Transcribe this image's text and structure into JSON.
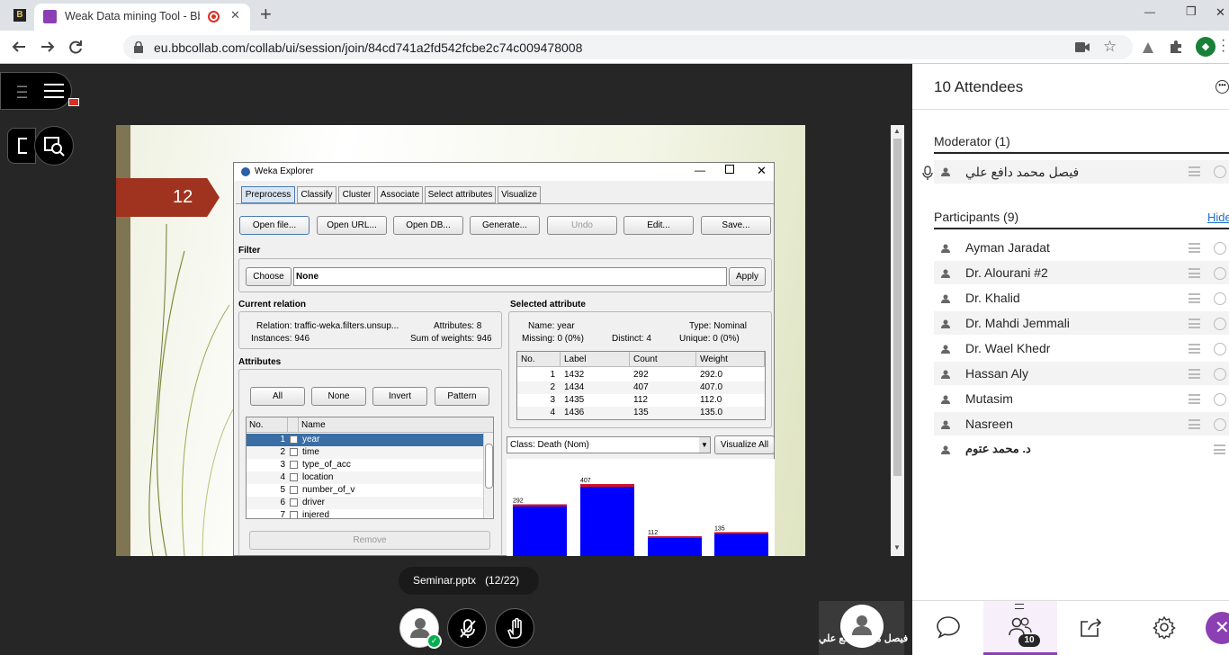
{
  "browser": {
    "tab_title": "Weak Data mining Tool - Bb",
    "url": "eu.bbcollab.com/collab/ui/session/join/84cd741a2fd542fcbe2c74c009478008",
    "pinned_tab_letter": "B",
    "profile_letter": "◆",
    "new_tab": "+",
    "window": {
      "minimize": "—",
      "restore": "❐",
      "close": "✕"
    }
  },
  "slide": {
    "number": "12",
    "file_label": "Seminar.pptx",
    "page_label": "(12/22)"
  },
  "weka": {
    "title": "Weka Explorer",
    "tabs": [
      "Preprocess",
      "Classify",
      "Cluster",
      "Associate",
      "Select attributes",
      "Visualize"
    ],
    "buttons": {
      "open_file": "Open file...",
      "open_url": "Open URL...",
      "open_db": "Open DB...",
      "generate": "Generate...",
      "undo": "Undo",
      "edit": "Edit...",
      "save": "Save..."
    },
    "filter": {
      "label": "Filter",
      "choose": "Choose",
      "value": "None",
      "apply": "Apply"
    },
    "relation": {
      "header": "Current relation",
      "relation": "Relation: traffic-weka.filters.unsup...",
      "instances": "Instances: 946",
      "attributes": "Attributes: 8",
      "weights": "Sum of weights: 946"
    },
    "attributes": {
      "header": "Attributes",
      "all": "All",
      "none": "None",
      "invert": "Invert",
      "pattern": "Pattern",
      "col_no": "No.",
      "col_name": "Name",
      "remove": "Remove",
      "rows": [
        {
          "no": "1",
          "name": "year"
        },
        {
          "no": "2",
          "name": "time"
        },
        {
          "no": "3",
          "name": "type_of_acc"
        },
        {
          "no": "4",
          "name": "location"
        },
        {
          "no": "5",
          "name": "number_of_v"
        },
        {
          "no": "6",
          "name": "driver"
        },
        {
          "no": "7",
          "name": "injered"
        }
      ]
    },
    "selected": {
      "header": "Selected attribute",
      "name": "Name: year",
      "type": "Type: Nominal",
      "missing": "Missing: 0 (0%)",
      "distinct": "Distinct: 4",
      "unique": "Unique: 0 (0%)",
      "cols": [
        "No.",
        "Label",
        "Count",
        "Weight"
      ],
      "rows": [
        [
          "1",
          "1432",
          "292",
          "292.0"
        ],
        [
          "2",
          "1434",
          "407",
          "407.0"
        ],
        [
          "3",
          "1435",
          "112",
          "112.0"
        ],
        [
          "4",
          "1436",
          "135",
          "135.0"
        ]
      ]
    },
    "class_select": "Class: Death (Nom)",
    "visualize_all": "Visualize All"
  },
  "chart_data": {
    "type": "bar",
    "categories": [
      "1432",
      "1434",
      "1435",
      "1436"
    ],
    "values": [
      292,
      407,
      112,
      135
    ],
    "colors": {
      "main": "#0000ff",
      "cap": "#d0102c"
    }
  },
  "panel": {
    "title": "10 Attendees",
    "moderator_header": "Moderator (1)",
    "moderator_name": "فيصل محمد دافع علي",
    "participants_header": "Participants (9)",
    "hide_link": "Hide",
    "participants": [
      "Ayman Jaradat",
      "Dr. Alourani #2",
      "Dr. Khalid",
      "Dr. Mahdi Jemmali",
      "Dr. Wael Khedr",
      "Hassan Aly",
      "Mutasim",
      "Nasreen",
      "د. محمد عتوم"
    ],
    "attendee_count": "10"
  },
  "presenter": {
    "name": "فيصل محمد دافع علي"
  },
  "colors": {
    "accent_purple": "#8c3fb3",
    "slide_arrow": "#a0331f",
    "weka_select": "#3a6ea5",
    "green": "#00b050"
  }
}
